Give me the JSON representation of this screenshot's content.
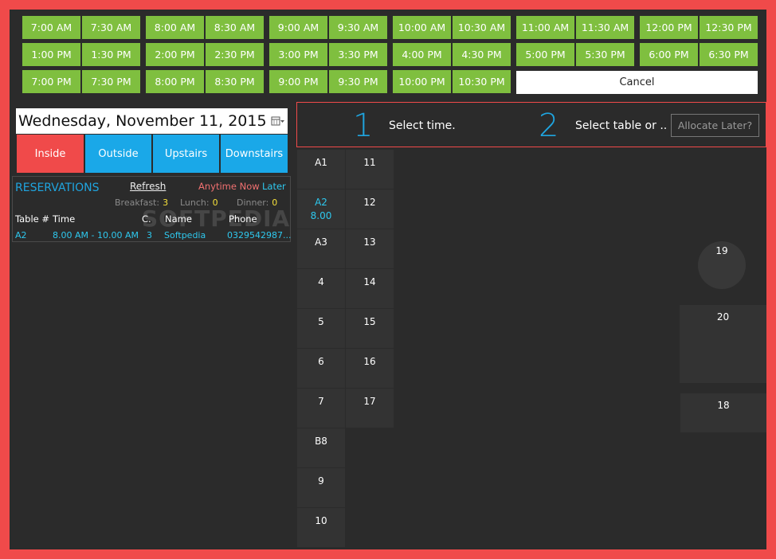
{
  "time_slots": [
    "7:00 AM",
    "7:30 AM",
    "8:00 AM",
    "8:30 AM",
    "9:00 AM",
    "9:30 AM",
    "10:00 AM",
    "10:30 AM",
    "11:00 AM",
    "11:30 AM",
    "12:00 PM",
    "12:30 PM",
    "1:00 PM",
    "1:30 PM",
    "2:00 PM",
    "2:30 PM",
    "3:00 PM",
    "3:30 PM",
    "4:00 PM",
    "4:30 PM",
    "5:00 PM",
    "5:30 PM",
    "6:00 PM",
    "6:30 PM",
    "7:00 PM",
    "7:30 PM",
    "8:00 PM",
    "8:30 PM",
    "9:00 PM",
    "9:30 PM",
    "10:00 PM",
    "10:30 PM"
  ],
  "cancel_label": "Cancel",
  "date": "Wednesday, November 11, 2015",
  "areas": [
    "Inside",
    "Outside",
    "Upstairs",
    "Downstairs"
  ],
  "reservations": {
    "title": "RESERVATIONS",
    "refresh": "Refresh",
    "anytime_now": "Anytime Now",
    "later": "Later",
    "breakfast_label": "Breakfast:",
    "breakfast": "3",
    "lunch_label": "Lunch:",
    "lunch": "0",
    "dinner_label": "Dinner:",
    "dinner": "0",
    "columns": [
      "Table #",
      "Time",
      "C.",
      "Name",
      "Phone"
    ],
    "rows": [
      {
        "table": "A2",
        "time": "8.00 AM - 10.00 AM",
        "covers": "3",
        "name": "Softpedia",
        "phone": "0329542987..."
      }
    ]
  },
  "steps": {
    "one": "1",
    "one_label": "Select time.",
    "two": "2",
    "two_label": "Select table or ..",
    "allocate": "Allocate Later?"
  },
  "tables_col1": [
    {
      "name": "A1",
      "sub": ""
    },
    {
      "name": "A2",
      "sub": "8.00"
    },
    {
      "name": "A3",
      "sub": ""
    },
    {
      "name": "4",
      "sub": ""
    },
    {
      "name": "5",
      "sub": ""
    },
    {
      "name": "6",
      "sub": ""
    },
    {
      "name": "7",
      "sub": ""
    },
    {
      "name": "B8",
      "sub": ""
    },
    {
      "name": "9",
      "sub": ""
    },
    {
      "name": "10",
      "sub": ""
    }
  ],
  "tables_col2": [
    "11",
    "12",
    "13",
    "14",
    "15",
    "16",
    "17"
  ],
  "table_19": "19",
  "table_20": "20",
  "table_18": "18",
  "watermark": "SOFTPEDIA",
  "colors": {
    "slot": "#7fbf3f",
    "accent": "#1fa5e0",
    "inside": "#f04a4a",
    "area": "#1aa8e8",
    "frame": "#f04a4a"
  }
}
